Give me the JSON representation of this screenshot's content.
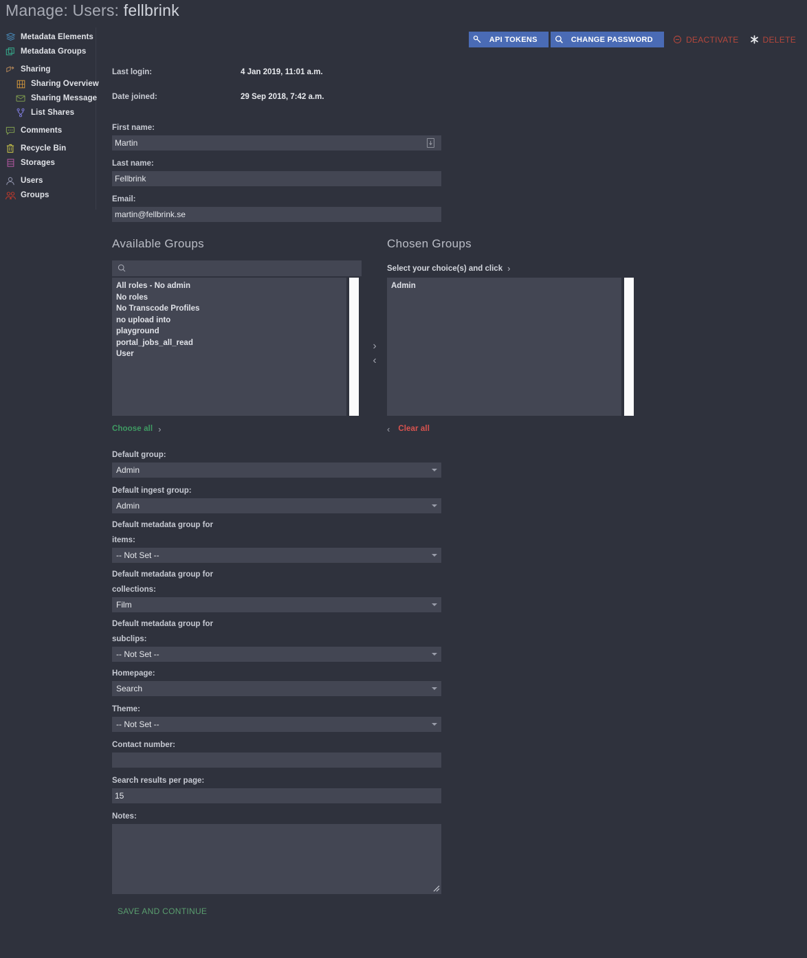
{
  "header": {
    "title_prefix": "Manage: Users:",
    "username": "fellbrink"
  },
  "sidebar": {
    "items": [
      {
        "label": "Metadata Elements",
        "icon": "layers-icon",
        "sub": false
      },
      {
        "label": "Metadata Groups",
        "icon": "copy-icon",
        "sub": false
      },
      {
        "label": "Sharing",
        "icon": "share-icon",
        "sub": false
      },
      {
        "label": "Sharing Overview",
        "icon": "grid-icon",
        "sub": true
      },
      {
        "label": "Sharing Message",
        "icon": "envelope-icon",
        "sub": true
      },
      {
        "label": "List Shares",
        "icon": "branch-icon",
        "sub": true
      },
      {
        "label": "Comments",
        "icon": "comment-icon",
        "sub": false
      },
      {
        "label": "Recycle Bin",
        "icon": "trash-icon",
        "sub": false
      },
      {
        "label": "Storages",
        "icon": "database-icon",
        "sub": false
      },
      {
        "label": "Users",
        "icon": "user-icon",
        "sub": false
      },
      {
        "label": "Groups",
        "icon": "users-icon",
        "sub": false
      }
    ]
  },
  "actions": {
    "api_tokens": "API TOKENS",
    "api_tokens_icon": "key-icon",
    "change_password": "CHANGE PASSWORD",
    "change_password_icon": "search-icon",
    "deactivate": "DEACTIVATE",
    "deactivate_icon": "minus-circle-icon",
    "delete": "DELETE",
    "delete_icon": "asterisk-icon"
  },
  "colors": {
    "primary_button": "#4a6bb5",
    "danger": "#b5473c",
    "success": "#3f9b63",
    "background": "#2f323d",
    "field": "#434653"
  },
  "meta": {
    "last_login_label": "Last login:",
    "last_login_value": "4 Jan 2019, 11:01 a.m.",
    "date_joined_label": "Date joined:",
    "date_joined_value": "29 Sep 2018, 7:42 a.m."
  },
  "form": {
    "first_name": {
      "label": "First name:",
      "value": "Martin",
      "placeholder": ""
    },
    "last_name": {
      "label": "Last name:",
      "value": "Fellbrink",
      "placeholder": ""
    },
    "email": {
      "label": "Email:",
      "value": "martin@fellbrink.se",
      "placeholder": ""
    },
    "default_group": {
      "label": "Default group:",
      "value": "Admin"
    },
    "default_ingest_group": {
      "label": "Default ingest group:",
      "value": "Admin"
    },
    "default_metadata_group_items": {
      "label_line1": "Default metadata group for",
      "label_line2": "items:",
      "value": "-- Not Set --"
    },
    "default_metadata_group_collections": {
      "label_line1": "Default metadata group for",
      "label_line2": "collections:",
      "value": "Film"
    },
    "default_metadata_group_subclips": {
      "label_line1": "Default metadata group for",
      "label_line2": "subclips:",
      "value": "-- Not Set --"
    },
    "homepage": {
      "label": "Homepage:",
      "value": "Search"
    },
    "theme": {
      "label": "Theme:",
      "value": "-- Not Set --"
    },
    "contact_number": {
      "label": "Contact number:",
      "value": "",
      "placeholder": ""
    },
    "search_results_per_page": {
      "label": "Search results per page:",
      "value": "15",
      "placeholder": ""
    },
    "notes": {
      "label": "Notes:",
      "value": "",
      "placeholder": ""
    },
    "save_label": "SAVE AND CONTINUE"
  },
  "groups": {
    "available_title": "Available Groups",
    "chosen_title": "Chosen Groups",
    "search_placeholder": "",
    "search_value": "",
    "chosen_hint": "Select your choice(s) and click",
    "available_items": [
      "All roles - No admin",
      "No roles",
      "No Transcode Profiles",
      "no upload into",
      "playground",
      "portal_jobs_all_read",
      "User"
    ],
    "chosen_items": [
      "Admin"
    ],
    "choose_all_label": "Choose all",
    "clear_all_label": "Clear all",
    "move_right_icon": "chevron-right-icon",
    "move_left_icon": "chevron-left-icon"
  }
}
